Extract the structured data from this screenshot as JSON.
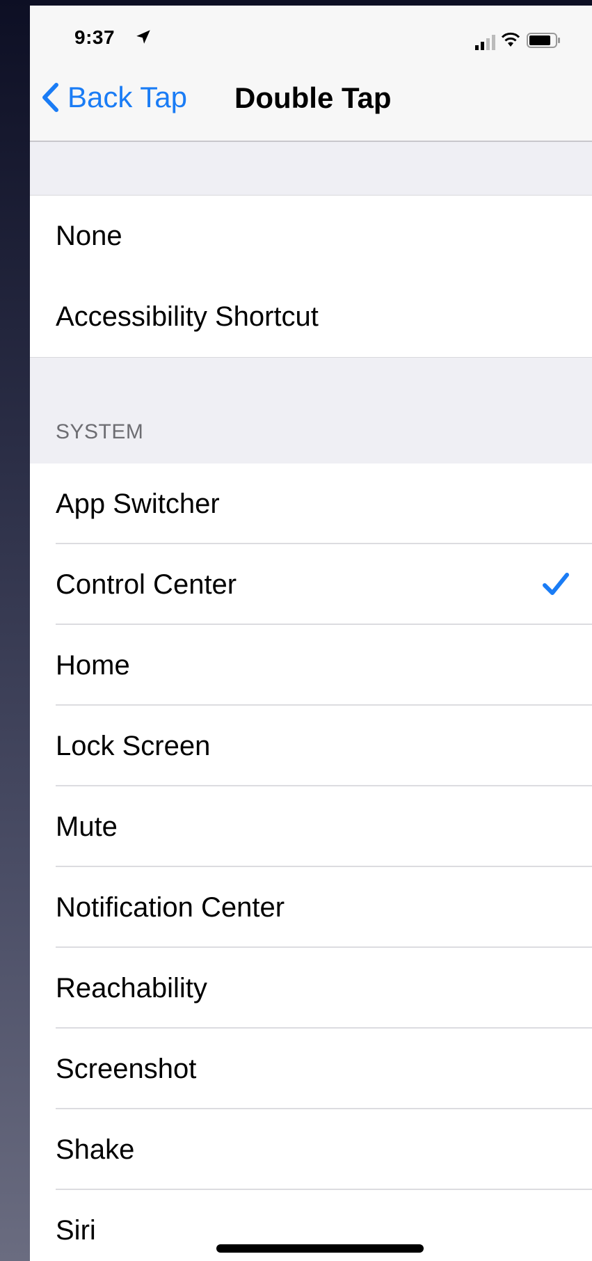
{
  "status_bar": {
    "time": "9:37",
    "icons": [
      "location-arrow-icon",
      "cellular-signal-icon",
      "wifi-icon",
      "battery-icon"
    ]
  },
  "nav": {
    "back_label": "Back Tap",
    "title": "Double Tap"
  },
  "top_group": {
    "items": [
      {
        "label": "None"
      },
      {
        "label": "Accessibility Shortcut"
      }
    ]
  },
  "system_section": {
    "header": "SYSTEM",
    "items": [
      {
        "label": "App Switcher",
        "selected": false
      },
      {
        "label": "Control Center",
        "selected": true
      },
      {
        "label": "Home",
        "selected": false
      },
      {
        "label": "Lock Screen",
        "selected": false
      },
      {
        "label": "Mute",
        "selected": false
      },
      {
        "label": "Notification Center",
        "selected": false
      },
      {
        "label": "Reachability",
        "selected": false
      },
      {
        "label": "Screenshot",
        "selected": false
      },
      {
        "label": "Shake",
        "selected": false
      },
      {
        "label": "Siri",
        "selected": false
      }
    ]
  },
  "colors": {
    "accent": "#1a7cf5",
    "grouped_background": "#efeff4",
    "cell_background": "#ffffff",
    "section_header_text": "#6d6d72"
  }
}
